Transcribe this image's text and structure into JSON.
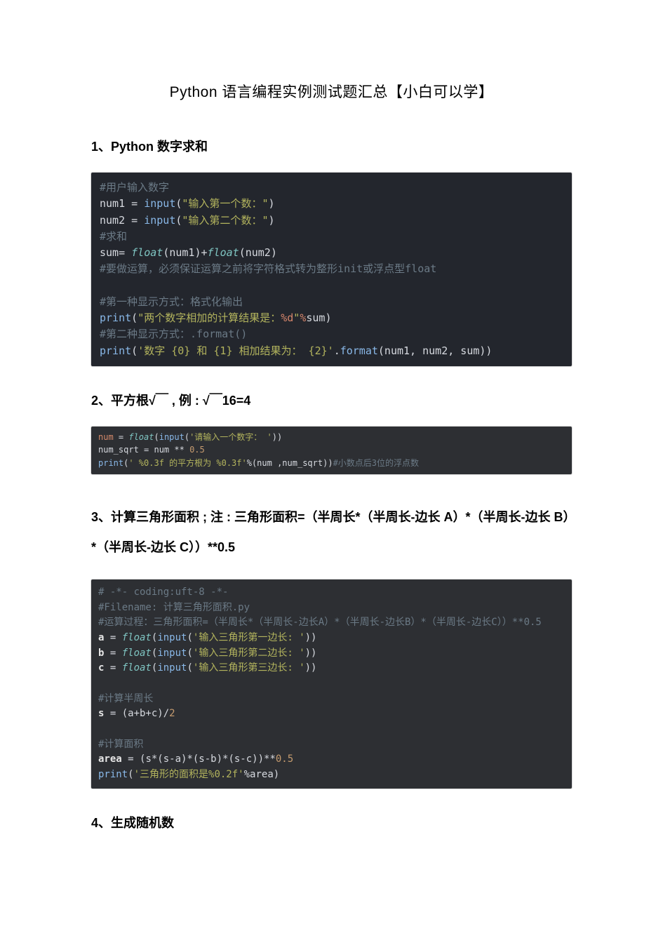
{
  "page_title": "Python 语言编程实例测试题汇总【小白可以学】",
  "section1": {
    "heading": "1、Python 数字求和"
  },
  "section2": {
    "heading": "2、平方根√￣ , 例 : √￣16=4"
  },
  "section3": {
    "heading": "3、计算三角形面积 ; 注  : 三角形面积=（半周长*（半周长-边长 A）*（半周长-边长 B）*（半周长-边长 C））**0.5"
  },
  "section4": {
    "heading": "4、生成随机数"
  },
  "code1": {
    "l1": "#用户输入数字",
    "l2a": "num1 ",
    "l2b": "=",
    "l2c": " ",
    "l2d": "input",
    "l2e": "(",
    "l2f": "\"输入第一个数：\"",
    "l2g": ")",
    "l3a": "num2 ",
    "l3b": "=",
    "l3c": " ",
    "l3d": "input",
    "l3e": "(",
    "l3f": "\"输入第二个数：\"",
    "l3g": ")",
    "l4": "#求和",
    "l5a": "sum",
    "l5b": "= ",
    "l5c": "float",
    "l5d": "(num1)",
    "l5e": "+",
    "l5f": "float",
    "l5g": "(num2)",
    "l6": "#要做运算，必须保证运算之前将字符格式转为整形init或浮点型float",
    "l7": "",
    "l8": "#第一种显示方式：格式化输出",
    "l9a": "print",
    "l9b": "(",
    "l9c": "\"两个数字相加的计算结果是：",
    "l9d": "%d",
    "l9e": "\"",
    "l9f": "%",
    "l9g": "sum",
    "l9h": ")",
    "l10": "#第二种显示方式：.format()",
    "l11a": "print",
    "l11b": "(",
    "l11c": "'数字 {0} 和 {1} 相加结果为： {2}'",
    "l11d": ".",
    "l11e": "format",
    "l11f": "(num1, num2, sum))"
  },
  "code2": {
    "l1a": "num ",
    "l1b": "= ",
    "l1c": "float",
    "l1d": "(",
    "l1e": "input",
    "l1f": "(",
    "l1g": "'请输入一个数字： '",
    "l1h": "))",
    "l2a": "num_sqrt ",
    "l2b": "= num ** ",
    "l2c": "0.5",
    "l3a": "print",
    "l3b": "(",
    "l3c": "' %0.3f 的平方根为 %0.3f'",
    "l3d": "%(num ,num_sqrt))",
    "l3e": "#小数点后3位的浮点数"
  },
  "code3": {
    "l1": "# -*- coding:uft-8 -*-",
    "l2": "#Filename: 计算三角形面积.py",
    "l3": "#运算过程：三角形面积=（半周长*（半周长-边长A）*（半周长-边长B）*（半周长-边长C））**0.5",
    "l4a": "a ",
    "l4b": "= ",
    "l4c": "float",
    "l4d": "(",
    "l4e": "input",
    "l4f": "(",
    "l4g": "'输入三角形第一边长: '",
    "l4h": "))",
    "l5a": "b ",
    "l5b": "= ",
    "l5c": "float",
    "l5d": "(",
    "l5e": "input",
    "l5f": "(",
    "l5g": "'输入三角形第二边长: '",
    "l5h": "))",
    "l6a": "c ",
    "l6b": "= ",
    "l6c": "float",
    "l6d": "(",
    "l6e": "input",
    "l6f": "(",
    "l6g": "'输入三角形第三边长: '",
    "l6h": "))",
    "l7": "",
    "l8": "#计算半周长",
    "l9a": "s ",
    "l9b": "= (a+b+c)/",
    "l9c": "2",
    "l10": "",
    "l11": "#计算面积",
    "l12a": "area ",
    "l12b": "= (s*(s-a)*(s-b)*(s-c))**",
    "l12c": "0.5",
    "l13a": "print",
    "l13b": "(",
    "l13c": "'三角形的面积是%0.2f'",
    "l13d": "%area)"
  }
}
